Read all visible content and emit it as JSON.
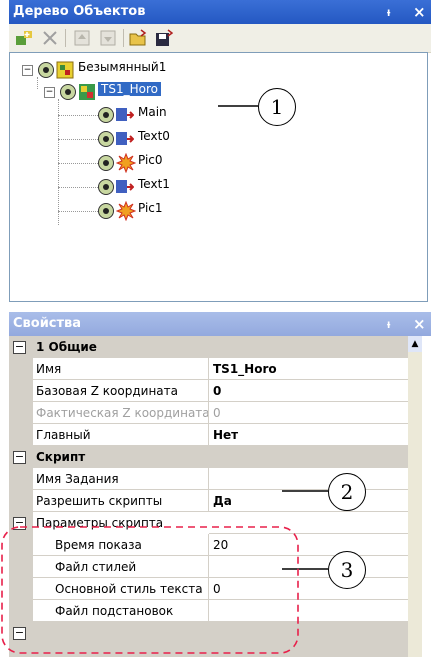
{
  "tree_panel": {
    "title": "Дерево Объектов",
    "pin": "ᵼ",
    "close": "×",
    "toolbar_icons": [
      "add-object-icon",
      "delete-icon",
      "move-up-icon",
      "move-down-icon",
      "open-icon",
      "save-icon"
    ],
    "nodes": {
      "root": "Безымянный1",
      "child": "TS1_Horo",
      "items": [
        "Main",
        "Text0",
        "Pic0",
        "Text1",
        "Pic1"
      ]
    }
  },
  "props_panel": {
    "title": "Свойства",
    "pin": "ᵼ",
    "close": "×",
    "cat_general": "1 Общие",
    "name_label": "Имя",
    "name_value": "TS1_Horo",
    "basez_label": "Базовая Z координата",
    "basez_value": "0",
    "factz_label": "Фактическая Z координата",
    "factz_value": "0",
    "main_label": "Главный",
    "main_value": "Нет",
    "cat_script": "Скрипт",
    "task_label": "Имя Задания",
    "task_value": "",
    "allow_label": "Разрешить скрипты",
    "allow_value": "Да",
    "params_label": "Параметры скрипта",
    "showtime_label": "Время показа",
    "showtime_value": "20",
    "styles_label": "Файл стилей",
    "styles_value": "",
    "mainstyle_label": "Основной стиль текста",
    "mainstyle_value": "0",
    "subst_label": "Файл подстановок",
    "subst_value": ""
  },
  "callouts": [
    "1",
    "2",
    "3"
  ],
  "colors": {
    "title_active": "#2458c2",
    "title_inactive": "#93a9de",
    "selection": "#316ac5"
  }
}
